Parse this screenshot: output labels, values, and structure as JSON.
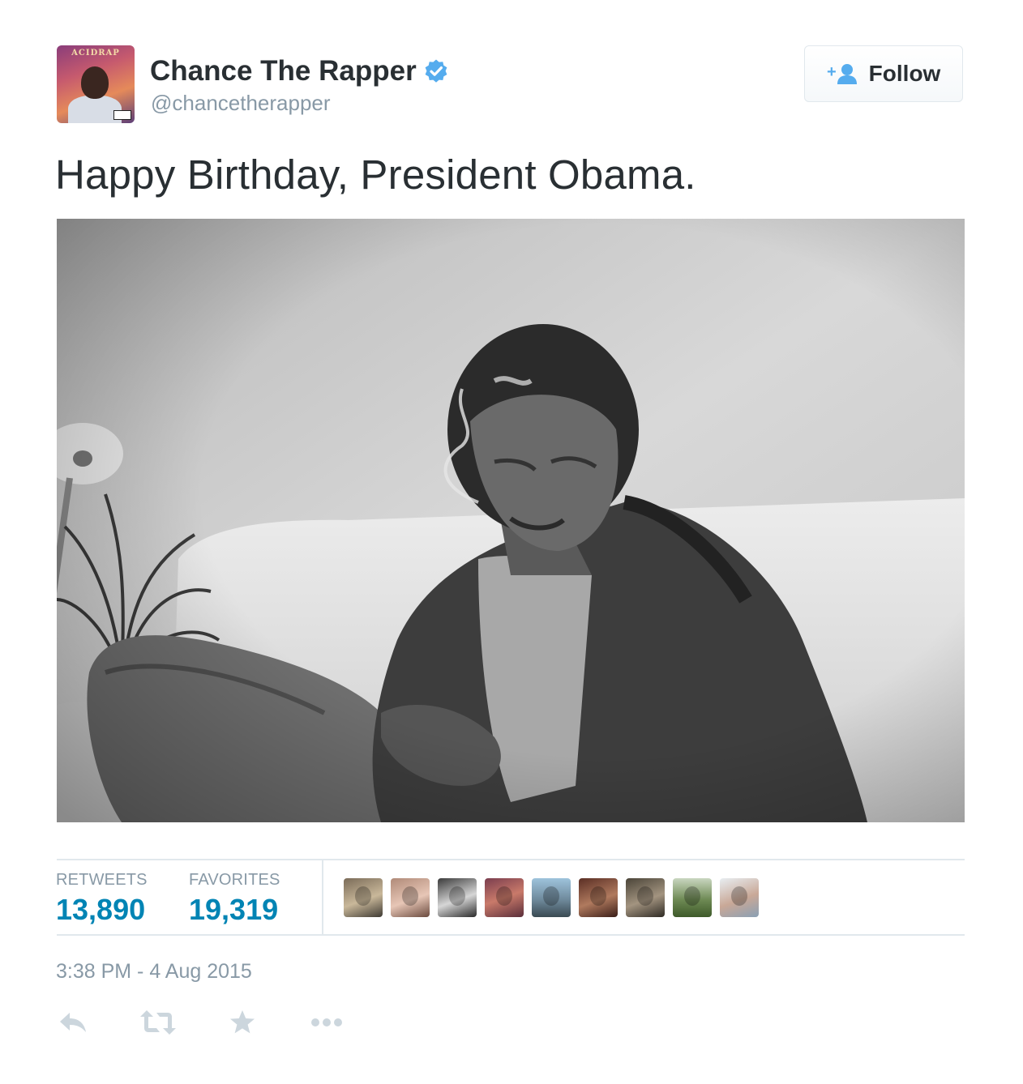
{
  "tweet": {
    "author": {
      "display_name": "Chance The Rapper",
      "handle": "@chancetherapper",
      "avatar_album_text": "ACIDRAP"
    },
    "follow_label": "Follow",
    "text": "Happy Birthday, President Obama.",
    "stats": {
      "retweets_label": "RETWEETS",
      "retweets_value": "13,890",
      "favorites_label": "FAVORITES",
      "favorites_value": "19,319"
    },
    "favoriters_count_shown": 9,
    "timestamp": "3:38 PM - 4 Aug 2015"
  },
  "icons": {
    "verified": "verified-badge-icon",
    "follow": "add-user-icon",
    "reply": "reply-icon",
    "retweet": "retweet-icon",
    "favorite": "star-icon",
    "more": "more-dots-icon"
  },
  "colors": {
    "link_blue": "#0084b4",
    "verified_blue": "#55acee",
    "muted_text": "#8899a6",
    "icon_gray": "#ccd6dd",
    "main_text": "#292f33"
  }
}
